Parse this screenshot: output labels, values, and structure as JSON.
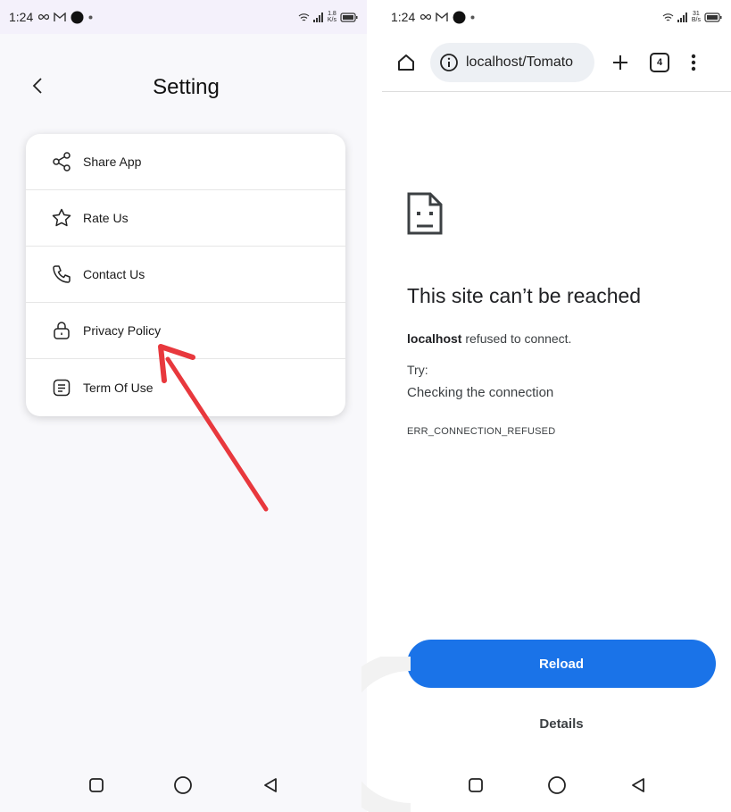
{
  "left_screen": {
    "status": {
      "time": "1:24",
      "speed_top": "1.8",
      "speed_bottom": "K/s"
    },
    "title": "Setting",
    "menu_items": [
      {
        "label": "Share App",
        "icon": "share-icon"
      },
      {
        "label": "Rate Us",
        "icon": "star-icon"
      },
      {
        "label": "Contact Us",
        "icon": "phone-icon"
      },
      {
        "label": "Privacy Policy",
        "icon": "lock-icon"
      },
      {
        "label": "Term Of Use",
        "icon": "document-icon"
      }
    ],
    "annotation_color": "#e8383d"
  },
  "right_screen": {
    "status": {
      "time": "1:24",
      "speed_top": "31",
      "speed_bottom": "B/s"
    },
    "url": "localhost/Tomato",
    "tab_count": "4",
    "error": {
      "title": "This site can’t be reached",
      "host": "localhost",
      "message": " refused to connect.",
      "try_label": "Try:",
      "suggestion": "Checking the connection",
      "code": "ERR_CONNECTION_REFUSED"
    },
    "reload_label": "Reload",
    "details_label": "Details",
    "accent_color": "#1a73e8"
  }
}
